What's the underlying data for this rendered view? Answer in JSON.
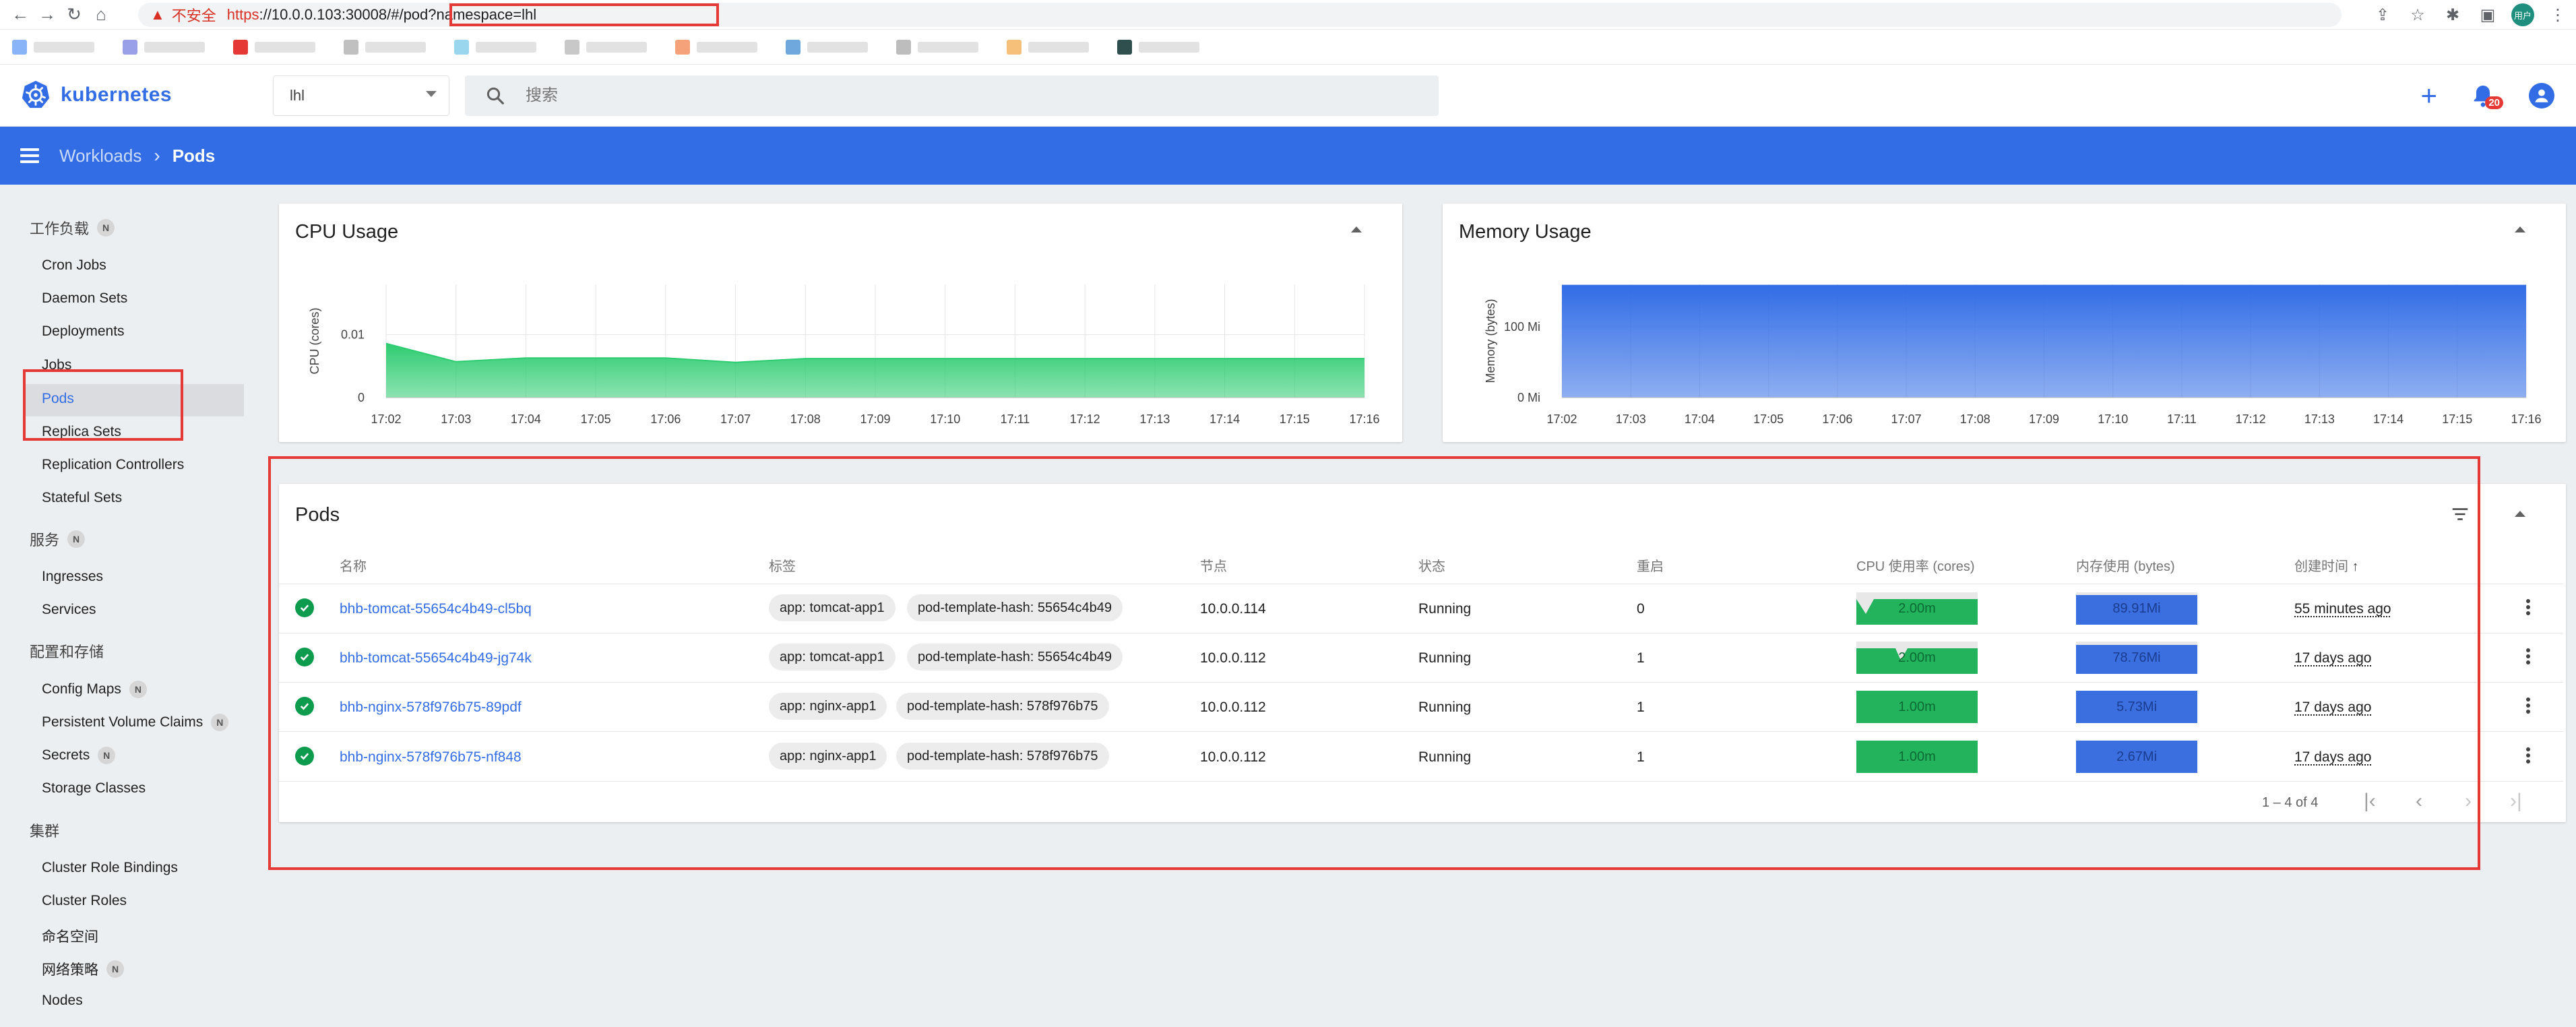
{
  "browser": {
    "insecure_label": "不安全",
    "url_proto": "https",
    "url_rest": "://10.0.0.103:30008/#/pod?namespace=lhl",
    "profile_initials": "用户"
  },
  "app": {
    "brand_name": "kubernetes",
    "namespace": "lhl",
    "search_placeholder": "搜索",
    "notification_count": "20"
  },
  "breadcrumb": {
    "parent": "Workloads",
    "separator": "›",
    "current": "Pods"
  },
  "sidebar": {
    "groups": [
      {
        "label": "工作负载",
        "badge": "N"
      },
      {
        "label": "服务",
        "badge": "N"
      },
      {
        "label": "配置和存储"
      },
      {
        "label": "集群"
      }
    ],
    "items": [
      {
        "label": "Cron Jobs"
      },
      {
        "label": "Daemon Sets"
      },
      {
        "label": "Deployments"
      },
      {
        "label": "Jobs"
      },
      {
        "label": "Pods"
      },
      {
        "label": "Replica Sets"
      },
      {
        "label": "Replication Controllers"
      },
      {
        "label": "Stateful Sets"
      },
      {
        "label": "Ingresses"
      },
      {
        "label": "Services"
      },
      {
        "label": "Config Maps",
        "badge": "N"
      },
      {
        "label": "Persistent Volume Claims",
        "badge": "N"
      },
      {
        "label": "Secrets",
        "badge": "N"
      },
      {
        "label": "Storage Classes"
      },
      {
        "label": "Cluster Role Bindings"
      },
      {
        "label": "Cluster Roles"
      },
      {
        "label": "命名空间"
      },
      {
        "label": "网络策略",
        "badge": "N"
      },
      {
        "label": "Nodes"
      }
    ]
  },
  "cpu_card": {
    "title": "CPU Usage"
  },
  "memory_card": {
    "title": "Memory Usage"
  },
  "chart_data": [
    {
      "type": "area",
      "title": "CPU Usage",
      "ylabel": "CPU (cores)",
      "x": [
        "17:02",
        "17:03",
        "17:04",
        "17:05",
        "17:06",
        "17:07",
        "17:08",
        "17:09",
        "17:10",
        "17:11",
        "17:12",
        "17:13",
        "17:14",
        "17:15",
        "17:16"
      ],
      "yticks": [
        "0",
        "0.01"
      ],
      "ylim": [
        0,
        0.018
      ],
      "values": [
        0.0086,
        0.0057,
        0.0063,
        0.0063,
        0.0063,
        0.0056,
        0.0062,
        0.0062,
        0.0062,
        0.0062,
        0.0062,
        0.0062,
        0.0062,
        0.0062,
        0.0062
      ],
      "color": "#2ecc71"
    },
    {
      "type": "area",
      "title": "Memory Usage",
      "ylabel": "Memory (bytes)",
      "x": [
        "17:02",
        "17:03",
        "17:04",
        "17:05",
        "17:06",
        "17:07",
        "17:08",
        "17:09",
        "17:10",
        "17:11",
        "17:12",
        "17:13",
        "17:14",
        "17:15",
        "17:16"
      ],
      "yticks": [
        "0 Mi",
        "100 Mi"
      ],
      "ylim": [
        0,
        160
      ],
      "values": [
        175,
        175,
        175,
        175,
        175,
        175,
        175.5,
        176,
        176,
        176,
        176,
        176,
        176,
        176.5,
        177
      ],
      "color": "#326de6"
    }
  ],
  "pods": {
    "title": "Pods",
    "headers": {
      "name": "名称",
      "labels": "标签",
      "node": "节点",
      "status": "状态",
      "restarts": "重启",
      "cpu": "CPU 使用率 (cores)",
      "memory": "内存使用 (bytes)",
      "created": "创建时间",
      "sort_arrow": "↑"
    },
    "rows": [
      {
        "name": "bhb-tomcat-55654c4b49-cl5bq",
        "label_app": "app: tomcat-app1",
        "label_hash": "pod-template-hash: 55654c4b49",
        "node": "10.0.0.114",
        "status": "Running",
        "restarts": "0",
        "cpu": "2.00m",
        "cpu_fill": 0.68,
        "memory": "89.91Mi",
        "memory_fill": 0.86,
        "created": "55 minutes ago"
      },
      {
        "name": "bhb-tomcat-55654c4b49-jg74k",
        "label_app": "app: tomcat-app1",
        "label_hash": "pod-template-hash: 55654c4b49",
        "node": "10.0.0.112",
        "status": "Running",
        "restarts": "1",
        "cpu": "2.00m",
        "cpu_fill": 0.72,
        "memory": "78.76Mi",
        "memory_fill": 0.84,
        "created": "17 days ago"
      },
      {
        "name": "bhb-nginx-578f976b75-89pdf",
        "label_app": "app: nginx-app1",
        "label_hash": "pod-template-hash: 578f976b75",
        "node": "10.0.0.112",
        "status": "Running",
        "restarts": "1",
        "cpu": "1.00m",
        "cpu_fill": 1.0,
        "memory": "5.73Mi",
        "memory_fill": 1.0,
        "created": "17 days ago"
      },
      {
        "name": "bhb-nginx-578f976b75-nf848",
        "label_app": "app: nginx-app1",
        "label_hash": "pod-template-hash: 578f976b75",
        "node": "10.0.0.112",
        "status": "Running",
        "restarts": "1",
        "cpu": "1.00m",
        "cpu_fill": 1.0,
        "memory": "2.67Mi",
        "memory_fill": 1.0,
        "created": "17 days ago"
      }
    ],
    "pagination": "1 – 4 of 4"
  },
  "colors": {
    "brand_blue": "#326de6",
    "cpu_green": "#2ecc71",
    "memory_blue": "#326de6",
    "status_green": "#0d9c4d",
    "highlight_red": "#e53935"
  }
}
